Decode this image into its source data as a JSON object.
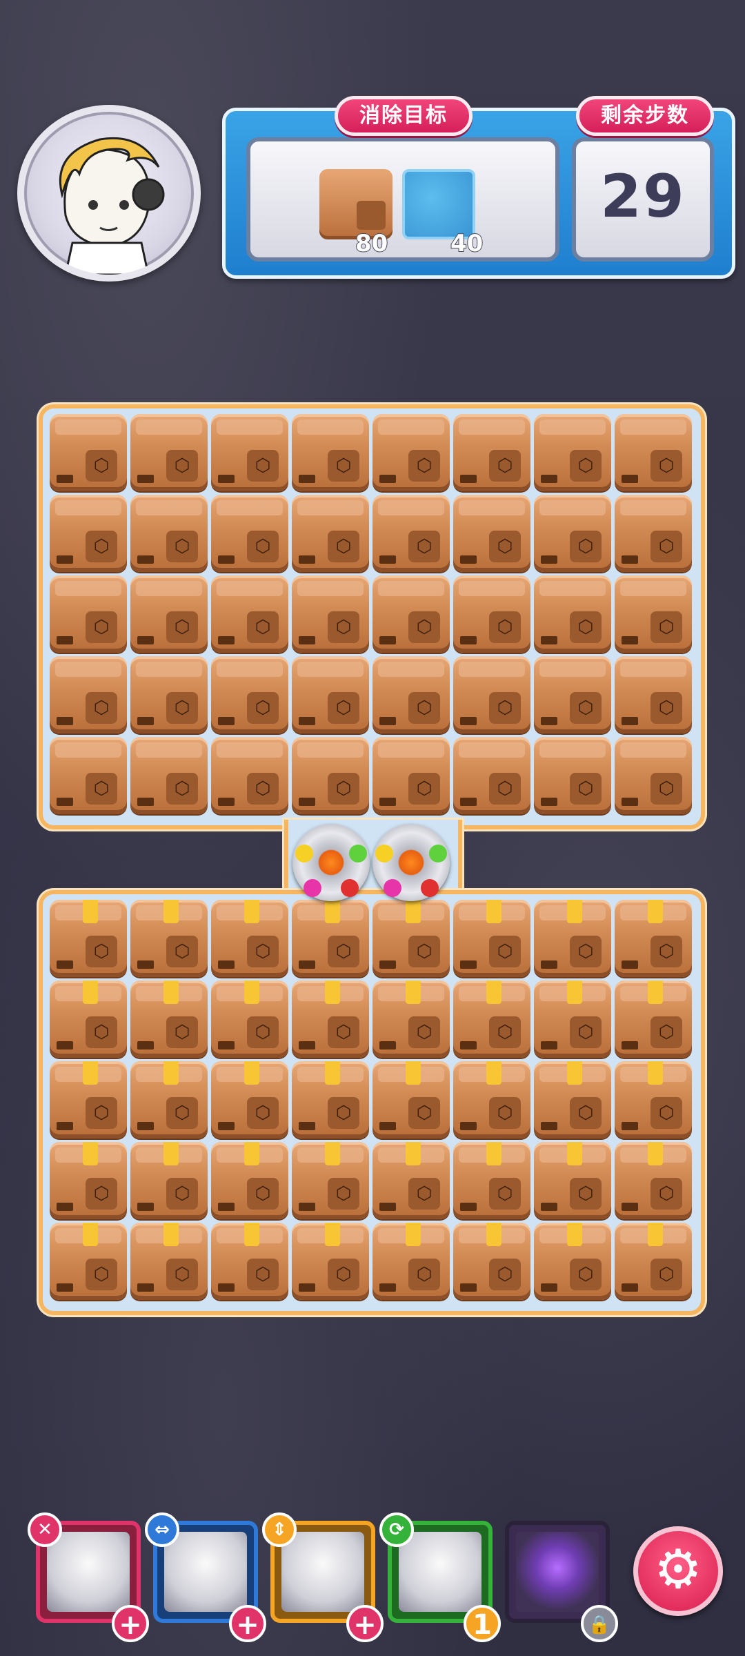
{
  "header": {
    "goal_label": "消除目标",
    "moves_label": "剩余步数",
    "moves_left": "29",
    "goals": [
      {
        "icon": "cardboard-box-icon",
        "count": "80"
      },
      {
        "icon": "ice-block-icon",
        "count": "40"
      }
    ]
  },
  "board": {
    "columns": 8,
    "top_rows": 5,
    "bottom_rows": 5,
    "top_tile": "cardboard-box",
    "bottom_tile": "taped-cardboard-box",
    "special_pieces": [
      "color-rocket",
      "color-rocket"
    ]
  },
  "colors": {
    "background": "#373648",
    "accent_pink": "#e0336a",
    "panel_blue": "#2b90da",
    "board_border": "#f6b561"
  },
  "boosters": [
    {
      "name": "hammer",
      "icon": "x-icon",
      "badge": "+",
      "color": "#e0336a"
    },
    {
      "name": "row-clear",
      "icon": "horizontal-arrows-icon",
      "badge": "+",
      "color": "#2f79d8"
    },
    {
      "name": "column-clear",
      "icon": "vertical-arrows-icon",
      "badge": "+",
      "color": "#f5a523"
    },
    {
      "name": "shuffle",
      "icon": "refresh-icon",
      "badge": "1",
      "color": "#35b239"
    },
    {
      "name": "locked-skill",
      "icon": "lock-icon",
      "badge": "",
      "color": "#5a3d80"
    }
  ]
}
